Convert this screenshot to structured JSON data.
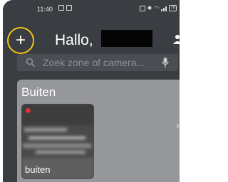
{
  "status_bar": {
    "time": "11:40",
    "battery": "78"
  },
  "header": {
    "add_button_label": "+",
    "greeting": "Hallo,"
  },
  "search": {
    "placeholder": "Zoek zone of camera..."
  },
  "zones": [
    {
      "title": "Buiten",
      "cameras": [
        {
          "name": "buiten",
          "recording": true
        }
      ]
    }
  ],
  "colors": {
    "background": "#3a3d41",
    "highlight": "#f3c417",
    "card": "#96979a",
    "recording": "#e03232"
  }
}
